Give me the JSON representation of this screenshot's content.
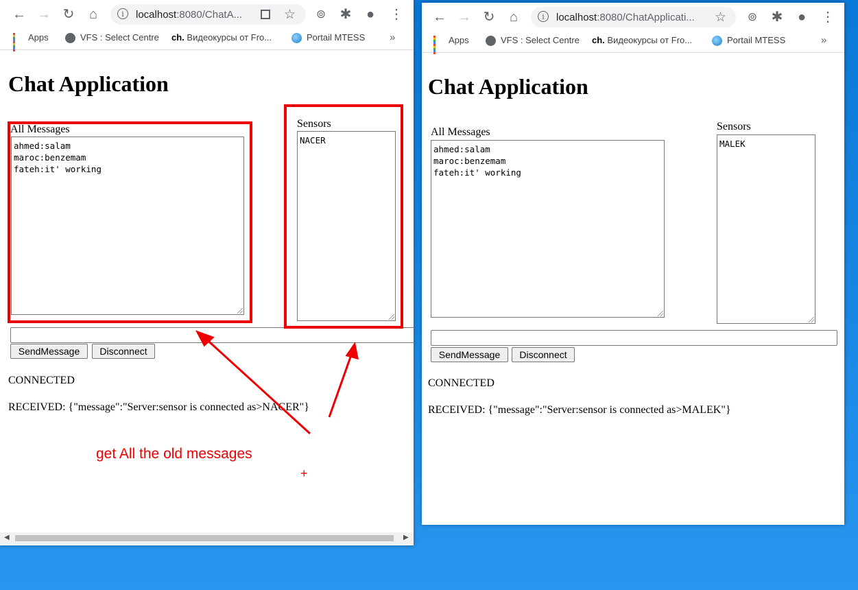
{
  "left_window": {
    "url_host": "localhost",
    "url_rest": ":8080/ChatA...",
    "bookmarks": {
      "apps": "Apps",
      "vfs": "VFS : Select Centre",
      "ch_prefix": "ch.",
      "video": "Видеокурсы от Fro...",
      "portail": "Portail MTESS",
      "more": "»"
    },
    "page": {
      "title": "Chat Application",
      "all_messages_label": "All Messages",
      "messages": "ahmed:salam\nmaroc:benzemam\nfateh:it' working",
      "sensors_label": "Sensors",
      "sensors": "NACER",
      "message_input_value": "",
      "send_button": "SendMessage",
      "disconnect_button": "Disconnect",
      "status": "CONNECTED",
      "received": "RECEIVED: {\"message\":\"Server:sensor is connected as>NACER\"}"
    },
    "annotation": {
      "text": "get All the old messages",
      "plus": "+",
      "color": "#e00000"
    }
  },
  "right_window": {
    "url_host": "localhost",
    "url_rest": ":8080/ChatApplicati...",
    "bookmarks": {
      "apps": "Apps",
      "vfs": "VFS : Select Centre",
      "ch_prefix": "ch.",
      "video": "Видеокурсы от Fro...",
      "portail": "Portail MTESS",
      "more": "»"
    },
    "page": {
      "title": "Chat Application",
      "all_messages_label": "All Messages",
      "messages": "ahmed:salam\nmaroc:benzemam\nfateh:it' working",
      "sensors_label": "Sensors",
      "sensors": "MALEK",
      "message_input_value": "",
      "send_button": "SendMessage",
      "disconnect_button": "Disconnect",
      "status": "CONNECTED",
      "received": "RECEIVED: {\"message\":\"Server:sensor is connected as>MALEK\"}"
    }
  },
  "icons": [
    "back-arrow-icon",
    "forward-arrow-icon",
    "reload-icon",
    "home-icon",
    "info-icon",
    "qr-code-icon",
    "star-icon",
    "extension-icon",
    "puzzle-icon",
    "account-icon",
    "menu-dots-icon"
  ],
  "colors": {
    "desktop": "#0a78d7",
    "annotation_red": "#e00000"
  }
}
